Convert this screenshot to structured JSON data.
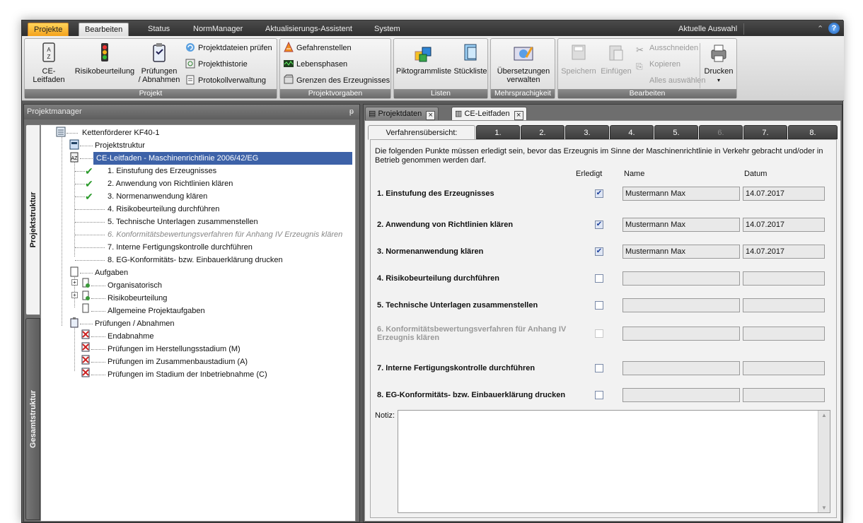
{
  "menu": {
    "tabs": [
      "Projekte",
      "Bearbeiten",
      "Status",
      "NormManager",
      "Aktualisierungs-Assistent",
      "System"
    ],
    "selection": "Aktuelle Auswahl"
  },
  "ribbon": {
    "projekt": {
      "label": "Projekt",
      "btn1": "CE-Leitfaden",
      "btn2": "Risikobeurteilung",
      "btn3a": "Prüfungen",
      "btn3b": "/ Abnahmen",
      "s1": "Projektdateien prüfen",
      "s2": "Projekthistorie",
      "s3": "Protokollverwaltung"
    },
    "vorgaben": {
      "label": "Projektvorgaben",
      "s1": "Gefahrenstellen",
      "s2": "Lebensphasen",
      "s3": "Grenzen des Erzeugnisses"
    },
    "listen": {
      "label": "Listen",
      "b1": "Piktogrammliste",
      "b2": "Stückliste"
    },
    "mehr": {
      "label": "Mehrsprachigkeit",
      "b1a": "Übersetzungen",
      "b1b": "verwalten"
    },
    "bearbeiten": {
      "label": "Bearbeiten",
      "b1": "Speichern",
      "b2": "Einfügen",
      "s1": "Ausschneiden",
      "s2": "Kopieren",
      "s3": "Alles auswählen",
      "b3": "Drucken"
    }
  },
  "left": {
    "title": "Projektmanager",
    "pin": "ᵽ",
    "vtab1": "Projektstruktur",
    "vtab2": "Gesamtstruktur"
  },
  "tree": [
    "Kettenförderer KF40-1",
    "Projektstruktur",
    "CE-Leitfaden - Maschinenrichtlinie 2006/42/EG",
    "1. Einstufung des Erzeugnisses",
    "2. Anwendung von Richtlinien klären",
    "3. Normenanwendung klären",
    "4. Risikobeurteilung durchführen",
    "5. Technische Unterlagen zusammenstellen",
    "6. Konformitätsbewertungsverfahren für Anhang IV Erzeugnis klären",
    "7. Interne Fertigungskontrolle durchführen",
    "8. EG-Konformitäts- bzw. Einbauerklärung drucken",
    "Aufgaben",
    "Organisatorisch",
    "Risikobeurteilung",
    "Allgemeine Projektaufgaben",
    "Prüfungen / Abnahmen",
    "Endabnahme",
    "Prüfungen im Herstellungsstadium (M)",
    "Prüfungen im Zusammenbaustadium (A)",
    "Prüfungen im Stadium der Inbetriebnahme (C)"
  ],
  "docTabs": [
    "Projektdaten",
    "CE-Leitfaden"
  ],
  "subTabs": [
    "Verfahrensübersicht:",
    "1.",
    "2.",
    "3.",
    "4.",
    "5.",
    "6.",
    "7.",
    "8."
  ],
  "content": {
    "intro": "Die folgenden Punkte müssen erledigt sein, bevor das Erzeugnis im Sinne der Maschinenrichtlinie in Verkehr gebracht und/oder in Betrieb genommen werden darf.",
    "hErledigt": "Erledigt",
    "hName": "Name",
    "hDatum": "Datum",
    "notiz": "Notiz:",
    "rows": [
      {
        "label": "1. Einstufung des Erzeugnisses",
        "checked": true,
        "name": "Mustermann Max",
        "date": "14.07.2017"
      },
      {
        "label": "2. Anwendung von Richtlinien klären",
        "checked": true,
        "name": "Mustermann Max",
        "date": "14.07.2017"
      },
      {
        "label": "3. Normenanwendung klären",
        "checked": true,
        "name": "Mustermann Max",
        "date": "14.07.2017"
      },
      {
        "label": "4. Risikobeurteilung durchführen",
        "checked": false,
        "name": "",
        "date": ""
      },
      {
        "label": "5. Technische Unterlagen zusammenstellen",
        "checked": false,
        "name": "",
        "date": ""
      },
      {
        "label": "6. Konformitätsbewertungsverfahren für Anhang IV Erzeugnis klären",
        "checked": false,
        "name": "",
        "date": ""
      },
      {
        "label": "7. Interne Fertigungskontrolle durchführen",
        "checked": false,
        "name": "",
        "date": ""
      },
      {
        "label": "8. EG-Konformitäts- bzw. Einbauerklärung drucken",
        "checked": false,
        "name": "",
        "date": ""
      }
    ]
  },
  "icons": {
    "check": "✔",
    "box": "☑"
  }
}
